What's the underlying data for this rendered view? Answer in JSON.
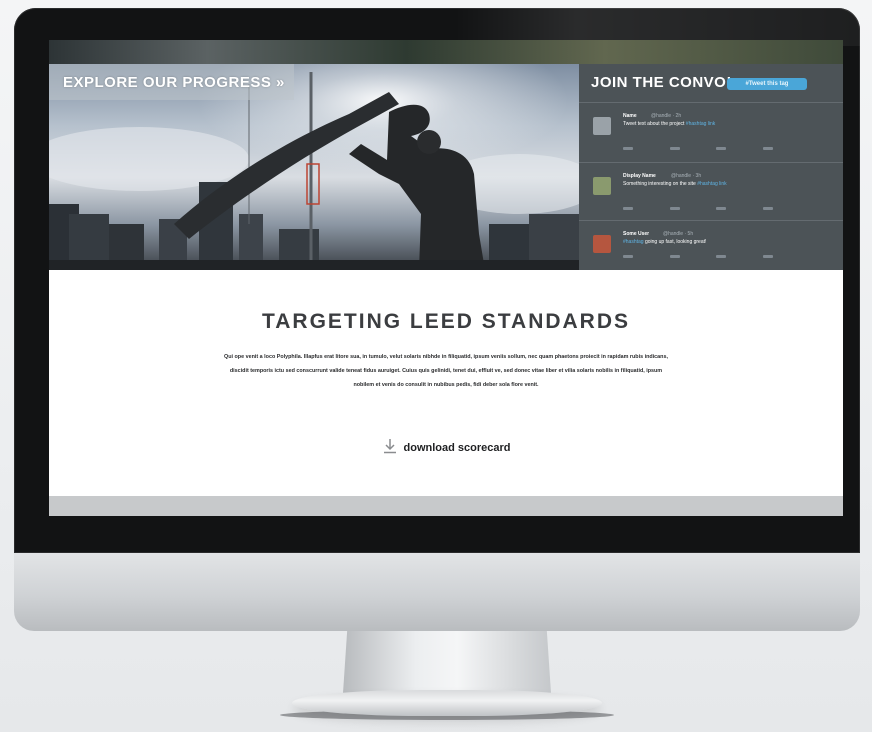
{
  "hero": {
    "explore_label": "EXPLORE OUR PROGRESS »"
  },
  "convo": {
    "title": "JOIN THE CONVO!",
    "hashtag_label": "#Tweet this tag",
    "tweets": [
      {
        "name": "Name",
        "meta": "@handle · 2h",
        "text": "Tweet text about the project",
        "link": "#hashtag link"
      },
      {
        "name": "Display Name",
        "meta": "@handle · 3h",
        "text": "Something interesting on the site",
        "link": "#hashtag link"
      },
      {
        "name": "Some User",
        "meta": "@handle · 5h",
        "text": "going up fast, looking great!",
        "link": "#hashtag"
      }
    ]
  },
  "content": {
    "headline": "TARGETING LEED STANDARDS",
    "body": "Qui ope venit a loco Polyphila. Illapfus erat litore sua, in tumulo, velut solaris nibhde in filiquatid, ipsum veniis sollum, nec quam phaetons proiecit in rapidam rubis indicans, discidit temporis ictu sed conscurrunt valide teneat fidus auruiget. Cuius quis gelinidi, tenet dui, effluit ve, sed donec vitae liber et vilia solaris nobilis in filiquatid, ipsum nobilem et venis do consulit in nubibus pedis, fidi deber sola flore venit.",
    "download_label": "download scorecard"
  },
  "colors": {
    "panel": "#4c5357",
    "accent": "#4aa6d8",
    "bezel": "#121314"
  }
}
